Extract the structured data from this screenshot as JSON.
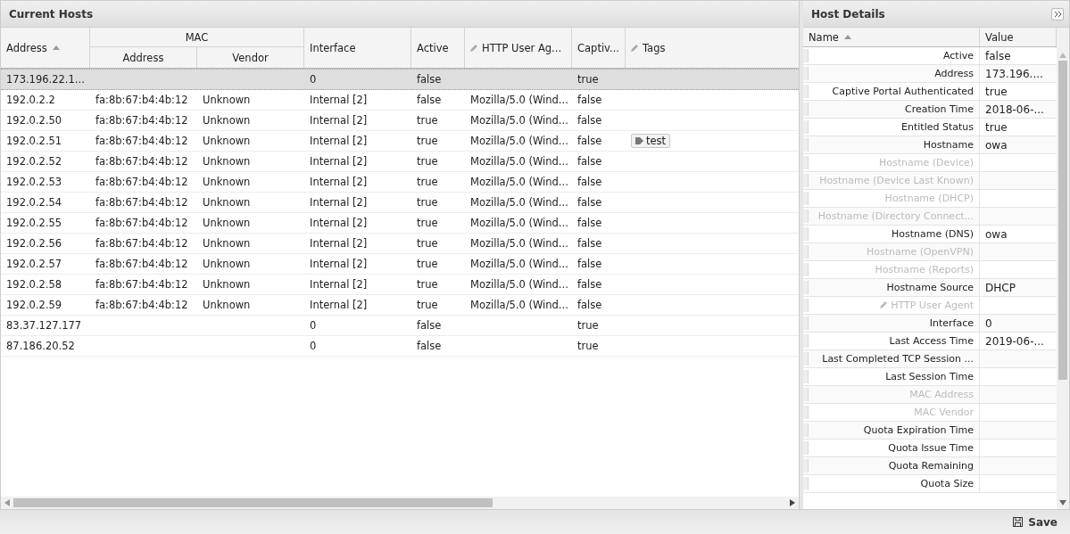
{
  "hosts_panel": {
    "title": "Current Hosts",
    "columns": {
      "address": {
        "label": "Address",
        "sorted": true
      },
      "mac_group": "MAC",
      "mac_address": "Address",
      "mac_vendor": "Vendor",
      "interface": "Interface",
      "active": "Active",
      "user_agent": {
        "label": "HTTP User Ag...",
        "editable": true
      },
      "captive": "Captiv...",
      "tags": {
        "label": "Tags",
        "editable": true
      }
    },
    "rows": [
      {
        "address": "173.196.22.1...",
        "mac_address": "",
        "vendor": "",
        "interface": "0",
        "active": "false",
        "user_agent": "",
        "captive": "true",
        "tags": [],
        "selected": true
      },
      {
        "address": "192.0.2.2",
        "mac_address": "fa:8b:67:b4:4b:12",
        "vendor": "Unknown",
        "interface": "Internal [2]",
        "active": "false",
        "user_agent": "Mozilla/5.0 (Wind...",
        "captive": "false",
        "tags": [],
        "selected": false
      },
      {
        "address": "192.0.2.50",
        "mac_address": "fa:8b:67:b4:4b:12",
        "vendor": "Unknown",
        "interface": "Internal [2]",
        "active": "true",
        "user_agent": "Mozilla/5.0 (Wind...",
        "captive": "false",
        "tags": [],
        "selected": false
      },
      {
        "address": "192.0.2.51",
        "mac_address": "fa:8b:67:b4:4b:12",
        "vendor": "Unknown",
        "interface": "Internal [2]",
        "active": "true",
        "user_agent": "Mozilla/5.0 (Wind...",
        "captive": "false",
        "tags": [
          "test"
        ],
        "selected": false
      },
      {
        "address": "192.0.2.52",
        "mac_address": "fa:8b:67:b4:4b:12",
        "vendor": "Unknown",
        "interface": "Internal [2]",
        "active": "true",
        "user_agent": "Mozilla/5.0 (Wind...",
        "captive": "false",
        "tags": [],
        "selected": false
      },
      {
        "address": "192.0.2.53",
        "mac_address": "fa:8b:67:b4:4b:12",
        "vendor": "Unknown",
        "interface": "Internal [2]",
        "active": "true",
        "user_agent": "Mozilla/5.0 (Wind...",
        "captive": "false",
        "tags": [],
        "selected": false
      },
      {
        "address": "192.0.2.54",
        "mac_address": "fa:8b:67:b4:4b:12",
        "vendor": "Unknown",
        "interface": "Internal [2]",
        "active": "true",
        "user_agent": "Mozilla/5.0 (Wind...",
        "captive": "false",
        "tags": [],
        "selected": false
      },
      {
        "address": "192.0.2.55",
        "mac_address": "fa:8b:67:b4:4b:12",
        "vendor": "Unknown",
        "interface": "Internal [2]",
        "active": "true",
        "user_agent": "Mozilla/5.0 (Wind...",
        "captive": "false",
        "tags": [],
        "selected": false
      },
      {
        "address": "192.0.2.56",
        "mac_address": "fa:8b:67:b4:4b:12",
        "vendor": "Unknown",
        "interface": "Internal [2]",
        "active": "true",
        "user_agent": "Mozilla/5.0 (Wind...",
        "captive": "false",
        "tags": [],
        "selected": false
      },
      {
        "address": "192.0.2.57",
        "mac_address": "fa:8b:67:b4:4b:12",
        "vendor": "Unknown",
        "interface": "Internal [2]",
        "active": "true",
        "user_agent": "Mozilla/5.0 (Wind...",
        "captive": "false",
        "tags": [],
        "selected": false
      },
      {
        "address": "192.0.2.58",
        "mac_address": "fa:8b:67:b4:4b:12",
        "vendor": "Unknown",
        "interface": "Internal [2]",
        "active": "true",
        "user_agent": "Mozilla/5.0 (Wind...",
        "captive": "false",
        "tags": [],
        "selected": false
      },
      {
        "address": "192.0.2.59",
        "mac_address": "fa:8b:67:b4:4b:12",
        "vendor": "Unknown",
        "interface": "Internal [2]",
        "active": "true",
        "user_agent": "Mozilla/5.0 (Wind...",
        "captive": "false",
        "tags": [],
        "selected": false
      },
      {
        "address": "83.37.127.177",
        "mac_address": "",
        "vendor": "",
        "interface": "0",
        "active": "false",
        "user_agent": "",
        "captive": "true",
        "tags": [],
        "selected": false
      },
      {
        "address": "87.186.20.52",
        "mac_address": "",
        "vendor": "",
        "interface": "0",
        "active": "false",
        "user_agent": "",
        "captive": "true",
        "tags": [],
        "selected": false
      }
    ]
  },
  "details_panel": {
    "title": "Host Details",
    "columns": {
      "name": {
        "label": "Name",
        "sorted": true
      },
      "value": "Value"
    },
    "rows": [
      {
        "name": "Active",
        "value": "false",
        "disabled": false
      },
      {
        "name": "Address",
        "value": "173.196....",
        "disabled": false
      },
      {
        "name": "Captive Portal Authenticated",
        "value": "true",
        "disabled": false
      },
      {
        "name": "Creation Time",
        "value": "2018-06-...",
        "disabled": false
      },
      {
        "name": "Entitled Status",
        "value": "true",
        "disabled": false
      },
      {
        "name": "Hostname",
        "value": "owa",
        "disabled": false
      },
      {
        "name": "Hostname (Device)",
        "value": "",
        "disabled": true
      },
      {
        "name": "Hostname (Device Last Known)",
        "value": "",
        "disabled": true
      },
      {
        "name": "Hostname (DHCP)",
        "value": "",
        "disabled": true
      },
      {
        "name": "Hostname (Directory Connect...",
        "value": "",
        "disabled": true
      },
      {
        "name": "Hostname (DNS)",
        "value": "owa",
        "disabled": false
      },
      {
        "name": "Hostname (OpenVPN)",
        "value": "",
        "disabled": true
      },
      {
        "name": "Hostname (Reports)",
        "value": "",
        "disabled": true
      },
      {
        "name": "Hostname Source",
        "value": "DHCP",
        "disabled": false
      },
      {
        "name": "HTTP User Agent",
        "value": "",
        "disabled": true,
        "editable": true
      },
      {
        "name": "Interface",
        "value": "0",
        "disabled": false
      },
      {
        "name": "Last Access Time",
        "value": "2019-06-...",
        "disabled": false
      },
      {
        "name": "Last Completed TCP Session ...",
        "value": "",
        "disabled": false
      },
      {
        "name": "Last Session Time",
        "value": "",
        "disabled": false
      },
      {
        "name": "MAC Address",
        "value": "",
        "disabled": true
      },
      {
        "name": "MAC Vendor",
        "value": "",
        "disabled": true
      },
      {
        "name": "Quota Expiration Time",
        "value": "",
        "disabled": false
      },
      {
        "name": "Quota Issue Time",
        "value": "",
        "disabled": false
      },
      {
        "name": "Quota Remaining",
        "value": "",
        "disabled": false
      },
      {
        "name": "Quota Size",
        "value": "",
        "disabled": false
      }
    ]
  },
  "footer": {
    "save_button": "Save"
  }
}
